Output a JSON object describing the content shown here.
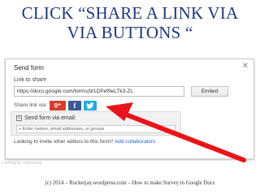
{
  "slide": {
    "title_line1": "CLICK “SHARE A LINK VIA",
    "title_line2": "VIA BUTTONS “",
    "footer": "(c) 2014 – Rockerjay.wordpress.com – How to make Survey in Google Docs",
    "faint_text": "Looking for responses",
    "arrow_color": "#e8141b",
    "title_color": "#1f3a78"
  },
  "dialog": {
    "title": "Send form",
    "close_glyph": "✕",
    "link_label": "Link to share",
    "link_value": "https://docs.google.com/forms/d/1DPef9eLTk3-ZL",
    "embed_label": "Embed",
    "share_label": "Share link via:",
    "social": [
      {
        "name": "google-plus",
        "glyph": "g+"
      },
      {
        "name": "facebook",
        "glyph": "f"
      },
      {
        "name": "twitter",
        "glyph": "twitter-bird"
      }
    ],
    "email": {
      "label": "Send form via email:",
      "checkbox_glyph": "×",
      "placeholder": "+ Enter names, email addresses, or groups"
    },
    "invite": {
      "text": "Looking to invite other editors to this form?",
      "link": "Add collaborators"
    }
  }
}
